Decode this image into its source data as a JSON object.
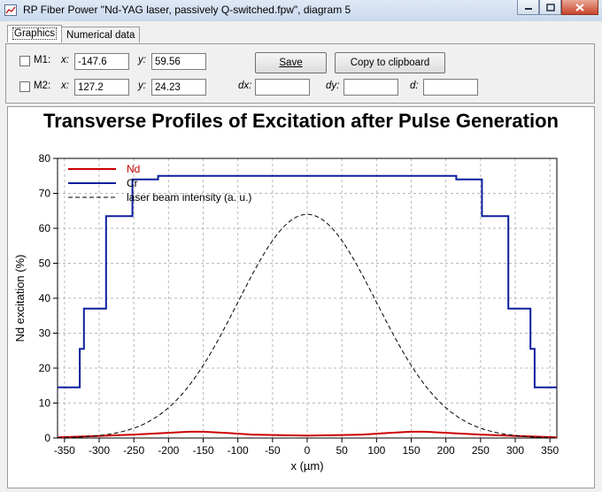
{
  "window": {
    "title": "RP Fiber Power \"Nd-YAG laser, passively Q-switched.fpw\", diagram 5",
    "minimize_icon": "minimize-icon",
    "maximize_icon": "maximize-icon",
    "close_icon": "close-icon"
  },
  "tabs": [
    {
      "label": "Graphics",
      "active": true
    },
    {
      "label": "Numerical data",
      "active": false
    }
  ],
  "markers": {
    "m1": {
      "label": "M1:",
      "x_label": "x:",
      "x_value": "-147.6",
      "y_label": "y:",
      "y_value": "59.56",
      "checked": false
    },
    "m2": {
      "label": "M2:",
      "x_label": "x:",
      "x_value": "127.2",
      "y_label": "y:",
      "y_value": "24.23",
      "checked": false
    },
    "dx_label": "dx:",
    "dx_value": "",
    "dy_label": "dy:",
    "dy_value": "",
    "d_label": "d:",
    "d_value": ""
  },
  "buttons": {
    "save": "Save",
    "copy": "Copy to clipboard"
  },
  "chart_data": {
    "type": "line",
    "title": "Transverse Profiles of Excitation after Pulse Generation",
    "xlabel": "x (µm)",
    "ylabel": "Nd excitation (%)",
    "xlim": [
      -360,
      360
    ],
    "ylim": [
      0,
      80
    ],
    "xticks": [
      -350,
      -300,
      -250,
      -200,
      -150,
      -100,
      -50,
      0,
      50,
      100,
      150,
      200,
      250,
      300,
      350
    ],
    "yticks": [
      0,
      10,
      20,
      30,
      40,
      50,
      60,
      70,
      80
    ],
    "grid": true,
    "legend_position": "top-left",
    "series": [
      {
        "name": "Nd",
        "color": "#cc0000",
        "style": "solid",
        "x": [
          -360,
          -300,
          -250,
          -200,
          -170,
          -150,
          -120,
          -80,
          -40,
          0,
          40,
          80,
          120,
          150,
          170,
          200,
          250,
          300,
          360
        ],
        "y": [
          0.2,
          0.6,
          1.0,
          1.5,
          1.8,
          1.8,
          1.5,
          1.0,
          0.8,
          0.7,
          0.8,
          1.0,
          1.5,
          1.8,
          1.8,
          1.5,
          1.0,
          0.6,
          0.2
        ]
      },
      {
        "name": "Cr",
        "color": "#0d1f9e",
        "style": "solid",
        "x": [
          -360,
          -328,
          -328,
          -322,
          -322,
          -290,
          -290,
          -252,
          -252,
          -215,
          -215,
          215,
          215,
          252,
          252,
          290,
          290,
          322,
          322,
          328,
          328,
          360
        ],
        "y": [
          14.5,
          14.5,
          25.5,
          25.5,
          37,
          37,
          63.5,
          63.5,
          74,
          74,
          75,
          75,
          74,
          74,
          63.5,
          63.5,
          37,
          37,
          25.5,
          25.5,
          14.5,
          14.5
        ]
      },
      {
        "name": "laser beam intensity (a. u.)",
        "color": "#000000",
        "style": "dashed",
        "peak": 64,
        "center": 0,
        "width_1e2": 200
      }
    ]
  }
}
